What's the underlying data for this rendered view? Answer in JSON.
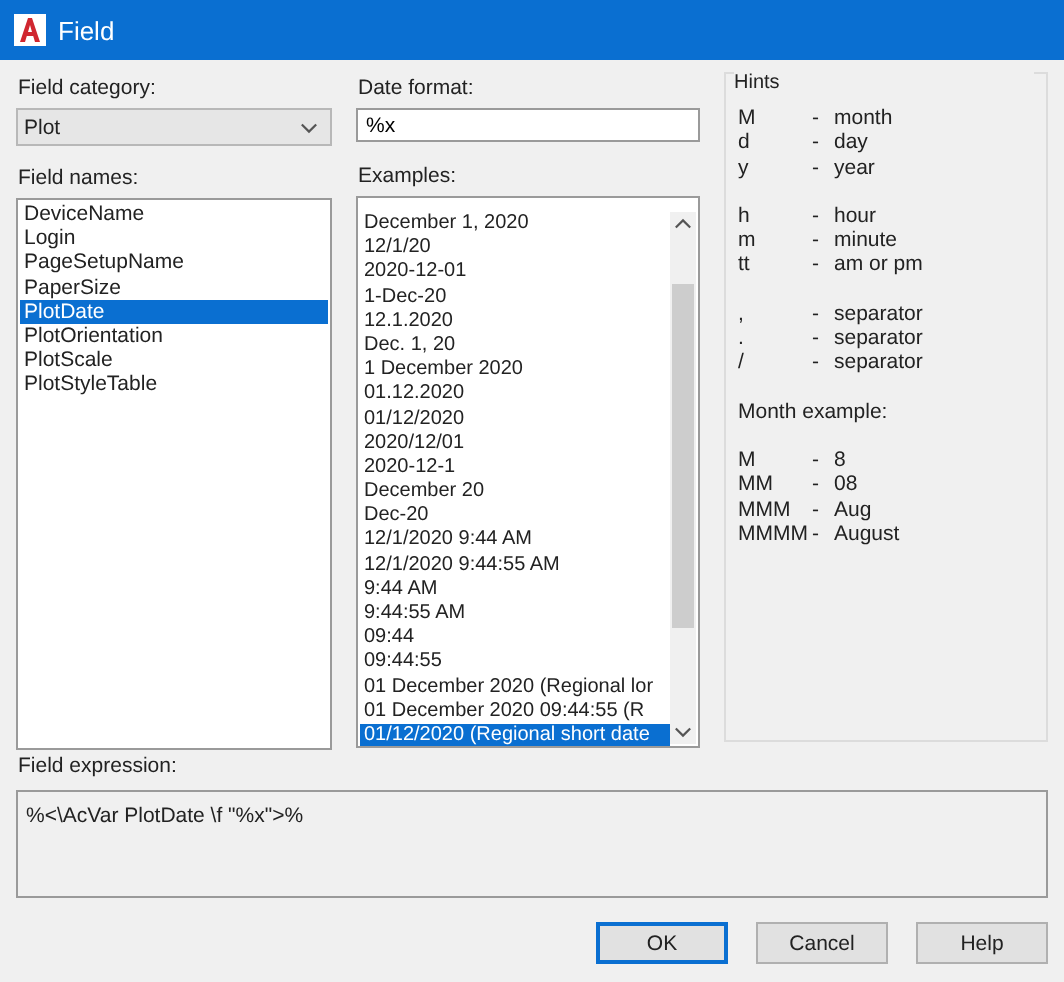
{
  "window": {
    "title": "Field"
  },
  "field_category": {
    "label": "Field category:",
    "value": "Plot"
  },
  "field_names": {
    "label": "Field names:",
    "items": [
      {
        "text": "DeviceName",
        "selected": false
      },
      {
        "text": "Login",
        "selected": false
      },
      {
        "text": "PageSetupName",
        "selected": false
      },
      {
        "text": "PaperSize",
        "selected": false
      },
      {
        "text": "PlotDate",
        "selected": true
      },
      {
        "text": "PlotOrientation",
        "selected": false
      },
      {
        "text": "PlotScale",
        "selected": false
      },
      {
        "text": "PlotStyleTable",
        "selected": false
      }
    ]
  },
  "date_format": {
    "label": "Date format:",
    "value": "%x"
  },
  "examples": {
    "label": "Examples:",
    "items": [
      {
        "text": "December 1, 2020",
        "selected": false
      },
      {
        "text": "12/1/20",
        "selected": false
      },
      {
        "text": "2020-12-01",
        "selected": false
      },
      {
        "text": "1-Dec-20",
        "selected": false
      },
      {
        "text": "12.1.2020",
        "selected": false
      },
      {
        "text": "Dec. 1, 20",
        "selected": false
      },
      {
        "text": "1 December 2020",
        "selected": false
      },
      {
        "text": "01.12.2020",
        "selected": false
      },
      {
        "text": "01/12/2020",
        "selected": false
      },
      {
        "text": "2020/12/01",
        "selected": false
      },
      {
        "text": "2020-12-1",
        "selected": false
      },
      {
        "text": "December 20",
        "selected": false
      },
      {
        "text": "Dec-20",
        "selected": false
      },
      {
        "text": "12/1/2020 9:44 AM",
        "selected": false
      },
      {
        "text": "12/1/2020 9:44:55 AM",
        "selected": false
      },
      {
        "text": "9:44 AM",
        "selected": false
      },
      {
        "text": "9:44:55 AM",
        "selected": false
      },
      {
        "text": "09:44",
        "selected": false
      },
      {
        "text": "09:44:55",
        "selected": false
      },
      {
        "text": "01 December 2020 (Regional lor",
        "selected": false
      },
      {
        "text": "01 December 2020 09:44:55 (R",
        "selected": false
      },
      {
        "text": "01/12/2020 (Regional short date",
        "selected": true
      }
    ]
  },
  "hints": {
    "title": "Hints",
    "groups": [
      [
        {
          "key": "M",
          "dash": "-",
          "meaning": "month"
        },
        {
          "key": "d",
          "dash": "-",
          "meaning": "day"
        },
        {
          "key": "y",
          "dash": "-",
          "meaning": "year"
        }
      ],
      [
        {
          "key": "h",
          "dash": "-",
          "meaning": "hour"
        },
        {
          "key": "m",
          "dash": "-",
          "meaning": "minute"
        },
        {
          "key": "tt",
          "dash": "-",
          "meaning": "am or pm"
        }
      ],
      [
        {
          "key": ",",
          "dash": "-",
          "meaning": "separator"
        },
        {
          "key": ".",
          "dash": "-",
          "meaning": "separator"
        },
        {
          "key": "/",
          "dash": "-",
          "meaning": "separator"
        }
      ]
    ],
    "month_example_label": "Month example:",
    "month_examples": [
      {
        "key": "M",
        "dash": "-",
        "meaning": "8"
      },
      {
        "key": "MM",
        "dash": "-",
        "meaning": "08"
      },
      {
        "key": "MMM",
        "dash": "-",
        "meaning": "Aug"
      },
      {
        "key": "MMMM",
        "dash": "-",
        "meaning": "August"
      }
    ]
  },
  "field_expression": {
    "label": "Field expression:",
    "value": "%<\\AcVar PlotDate \\f \"%x\">%"
  },
  "buttons": [
    {
      "label": "OK",
      "default": true
    },
    {
      "label": "Cancel",
      "default": false
    },
    {
      "label": "Help",
      "default": false
    }
  ]
}
